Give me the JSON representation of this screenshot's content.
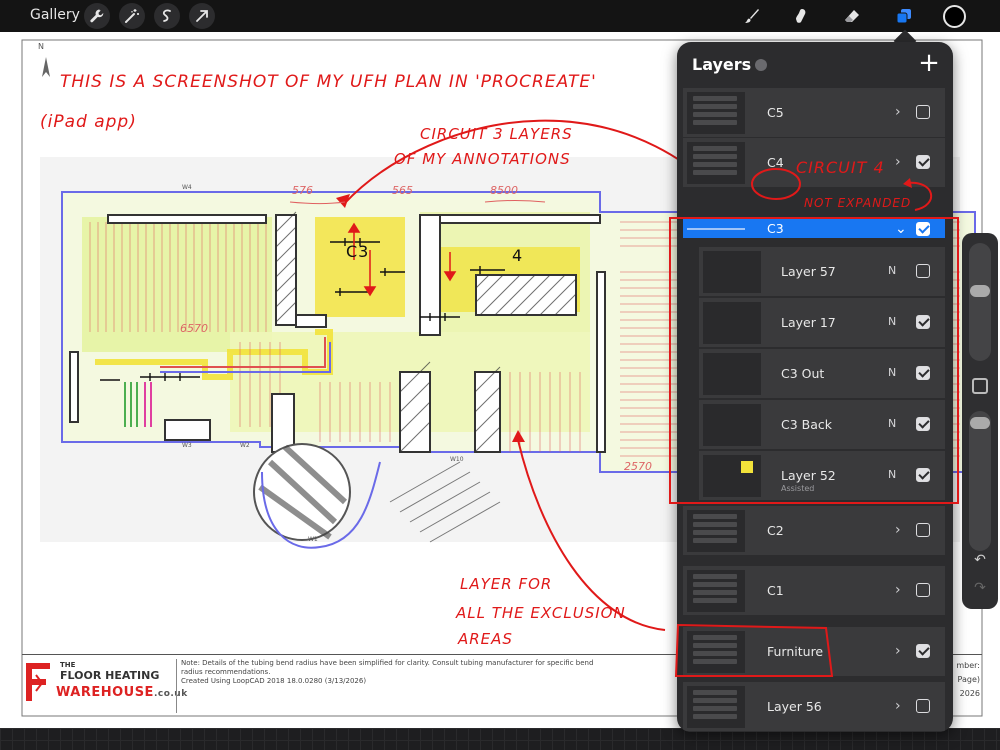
{
  "toolbar": {
    "gallery_label": "Gallery",
    "left_tools": [
      "wrench-icon",
      "magic-wand-icon",
      "selection-icon",
      "transform-arrow-icon"
    ],
    "right_tools": [
      "brush-icon",
      "smudge-icon",
      "eraser-icon",
      "layers-icon"
    ],
    "active_tool": "layers-icon",
    "current_color": "#000000"
  },
  "annotations": {
    "line1": "This is a screenshot of my UFH plan in 'Procreate'",
    "line2": "(iPad app)",
    "circuit3_line1": "Circuit 3 layers",
    "circuit3_line2": "of my annotations",
    "circuit4_label": "Circuit 4",
    "not_expanded": "not expanded",
    "exclusion_line1": "Layer for",
    "exclusion_line2": "all the exclusion",
    "exclusion_line3": "areas",
    "c3_room_label": "C3",
    "four_room_label": "4",
    "ink_color": "#e01919"
  },
  "plan": {
    "north_label": "N",
    "dimensions": [
      "576",
      "565",
      "8500",
      "6570",
      "2570"
    ],
    "wall_labels": [
      "W4",
      "W3",
      "W2",
      "W10",
      "W1"
    ],
    "accent_green": "#d9f07a",
    "accent_yellow": "#f2e23a",
    "pipe_red": "#e05050",
    "pipe_blue": "#4a4ae0"
  },
  "title_block": {
    "logo_the": "THE",
    "logo_floor": "FLOOR HEATING",
    "logo_warehouse": "WAREHOUSE",
    "logo_domain": ".co.uk",
    "notes": "Note: Details of the tubing bend radius have been simplified for clarity. Consult tubing manufacturer for specific bend radius recommendations.",
    "created": "Created Using LoopCAD 2018 18.0.0280 (3/13/2026)",
    "right_line1": "mber:",
    "right_line2": "Page)",
    "right_line3": "2026"
  },
  "layers_panel": {
    "title": "Layers",
    "add_label": "+",
    "layers": [
      {
        "name": "C5",
        "type": "group",
        "visible": false,
        "expanded": false,
        "selected": false
      },
      {
        "name": "C4",
        "type": "group",
        "visible": true,
        "expanded": false,
        "selected": false
      },
      {
        "name": "C3",
        "type": "group",
        "visible": true,
        "expanded": true,
        "selected": true
      },
      {
        "name": "Layer 57",
        "type": "layer",
        "blend": "N",
        "visible": false,
        "sublabel": ""
      },
      {
        "name": "Layer 17",
        "type": "layer",
        "blend": "N",
        "visible": true,
        "sublabel": ""
      },
      {
        "name": "C3 Out",
        "type": "layer",
        "blend": "N",
        "visible": true,
        "sublabel": ""
      },
      {
        "name": "C3 Back",
        "type": "layer",
        "blend": "N",
        "visible": true,
        "sublabel": ""
      },
      {
        "name": "Layer 52",
        "type": "layer",
        "blend": "N",
        "visible": true,
        "sublabel": "Assisted"
      },
      {
        "name": "C2",
        "type": "group",
        "visible": false,
        "expanded": false,
        "selected": false
      },
      {
        "name": "C1",
        "type": "group",
        "visible": false,
        "expanded": false,
        "selected": false
      },
      {
        "name": "Furniture",
        "type": "group",
        "visible": true,
        "expanded": false,
        "selected": false
      },
      {
        "name": "Layer 56",
        "type": "group",
        "visible": false,
        "expanded": false,
        "selected": false
      }
    ]
  },
  "sidebar": {
    "brush_size": 0.6,
    "opacity": 0.95,
    "undo_label": "↶",
    "redo_label": "↷"
  }
}
